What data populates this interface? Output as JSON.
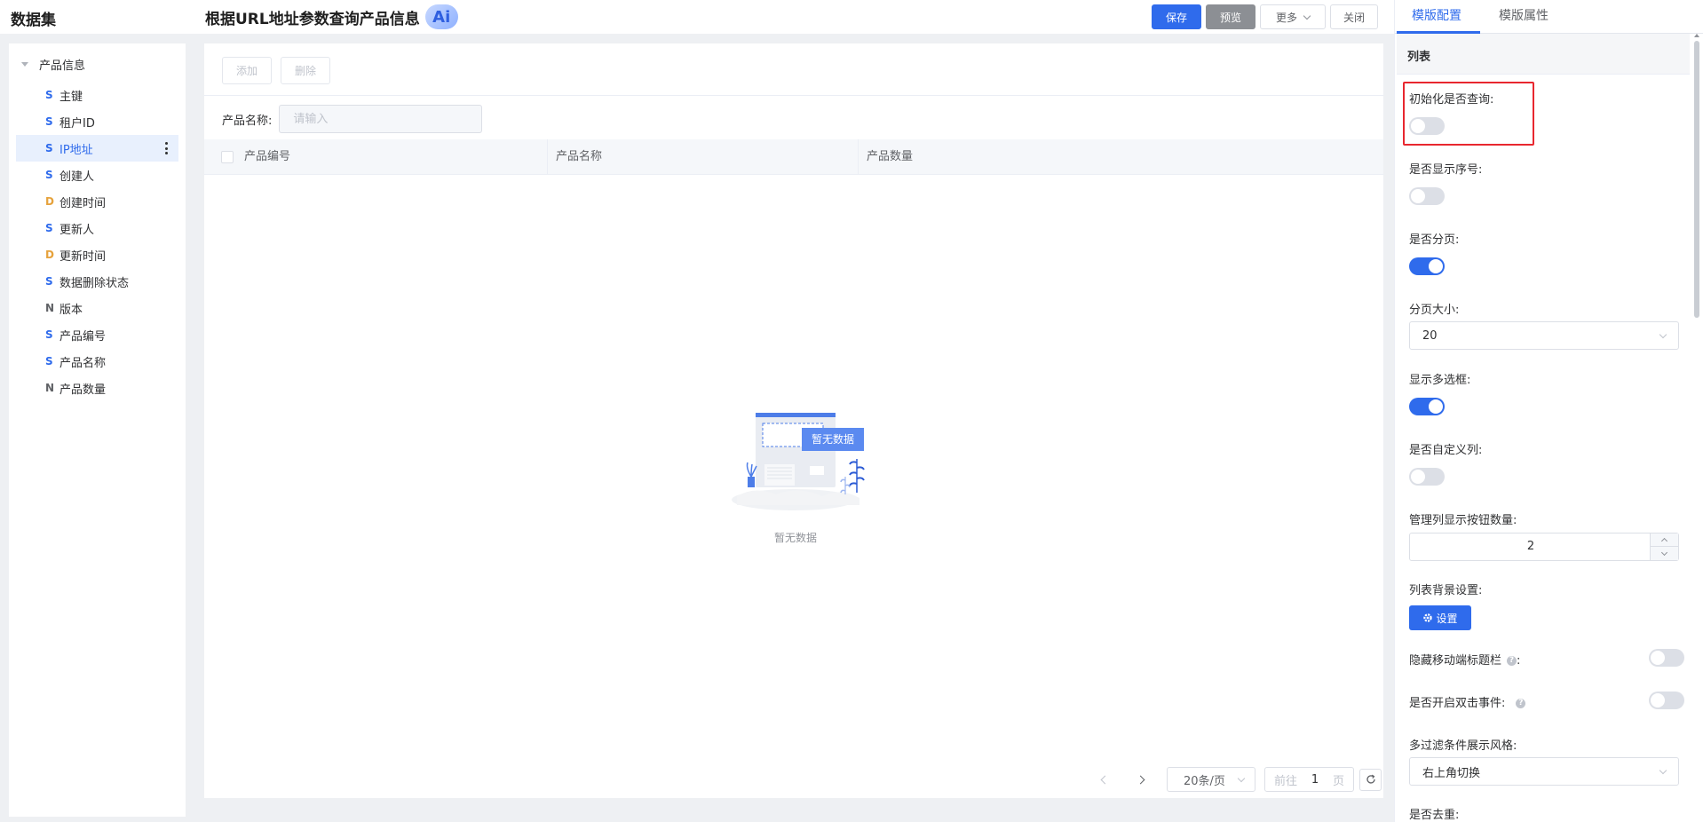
{
  "left": {
    "title": "数据集",
    "root_label": "产品信息",
    "fields": [
      {
        "type": "S",
        "label": "主键"
      },
      {
        "type": "S",
        "label": "租户ID"
      },
      {
        "type": "S",
        "label": "IP地址"
      },
      {
        "type": "S",
        "label": "创建人"
      },
      {
        "type": "D",
        "label": "创建时间"
      },
      {
        "type": "S",
        "label": "更新人"
      },
      {
        "type": "D",
        "label": "更新时间"
      },
      {
        "type": "S",
        "label": "数据删除状态"
      },
      {
        "type": "N",
        "label": "版本"
      },
      {
        "type": "S",
        "label": "产品编号"
      },
      {
        "type": "S",
        "label": "产品名称"
      },
      {
        "type": "N",
        "label": "产品数量"
      }
    ],
    "active_index": 2
  },
  "header": {
    "title": "根据URL地址参数查询产品信息",
    "ai_badge": "Ai",
    "save": "保存",
    "preview": "预览",
    "more": "更多",
    "close": "关闭"
  },
  "center": {
    "add": "添加",
    "delete": "删除",
    "search_label": "产品名称:",
    "search_placeholder": "请输入",
    "columns": [
      "产品编号",
      "产品名称",
      "产品数量"
    ],
    "empty_badge": "暂无数据",
    "empty_text": "暂无数据",
    "pager": {
      "page_size": "20条/页",
      "goto_prefix": "前往",
      "goto_value": "1",
      "goto_suffix": "页"
    }
  },
  "right": {
    "tabs": [
      "模版配置",
      "模版属性"
    ],
    "section": "列表",
    "props": {
      "init_query": {
        "label": "初始化是否查询:",
        "on": false
      },
      "show_index": {
        "label": "是否显示序号:",
        "on": false
      },
      "paging": {
        "label": "是否分页:",
        "on": true
      },
      "page_size": {
        "label": "分页大小:",
        "value": "20"
      },
      "multi_select": {
        "label": "显示多选框:",
        "on": true
      },
      "custom_columns": {
        "label": "是否自定义列:",
        "on": false
      },
      "action_count": {
        "label": "管理列显示按钮数量:",
        "value": "2"
      },
      "bg_setting": {
        "label": "列表背景设置:",
        "button": "设置"
      },
      "hide_mobile_title": {
        "label": "隐藏移动端标题栏",
        "suffix": ":",
        "on": false
      },
      "dblclick": {
        "label": "是否开启双击事件:",
        "on": false
      },
      "filter_style": {
        "label": "多过滤条件展示风格:",
        "value": "右上角切换"
      },
      "dedupe": {
        "label": "是否去重:"
      }
    }
  },
  "colors": {
    "primary": "#2f6bec",
    "highlight": "#e8272f"
  }
}
